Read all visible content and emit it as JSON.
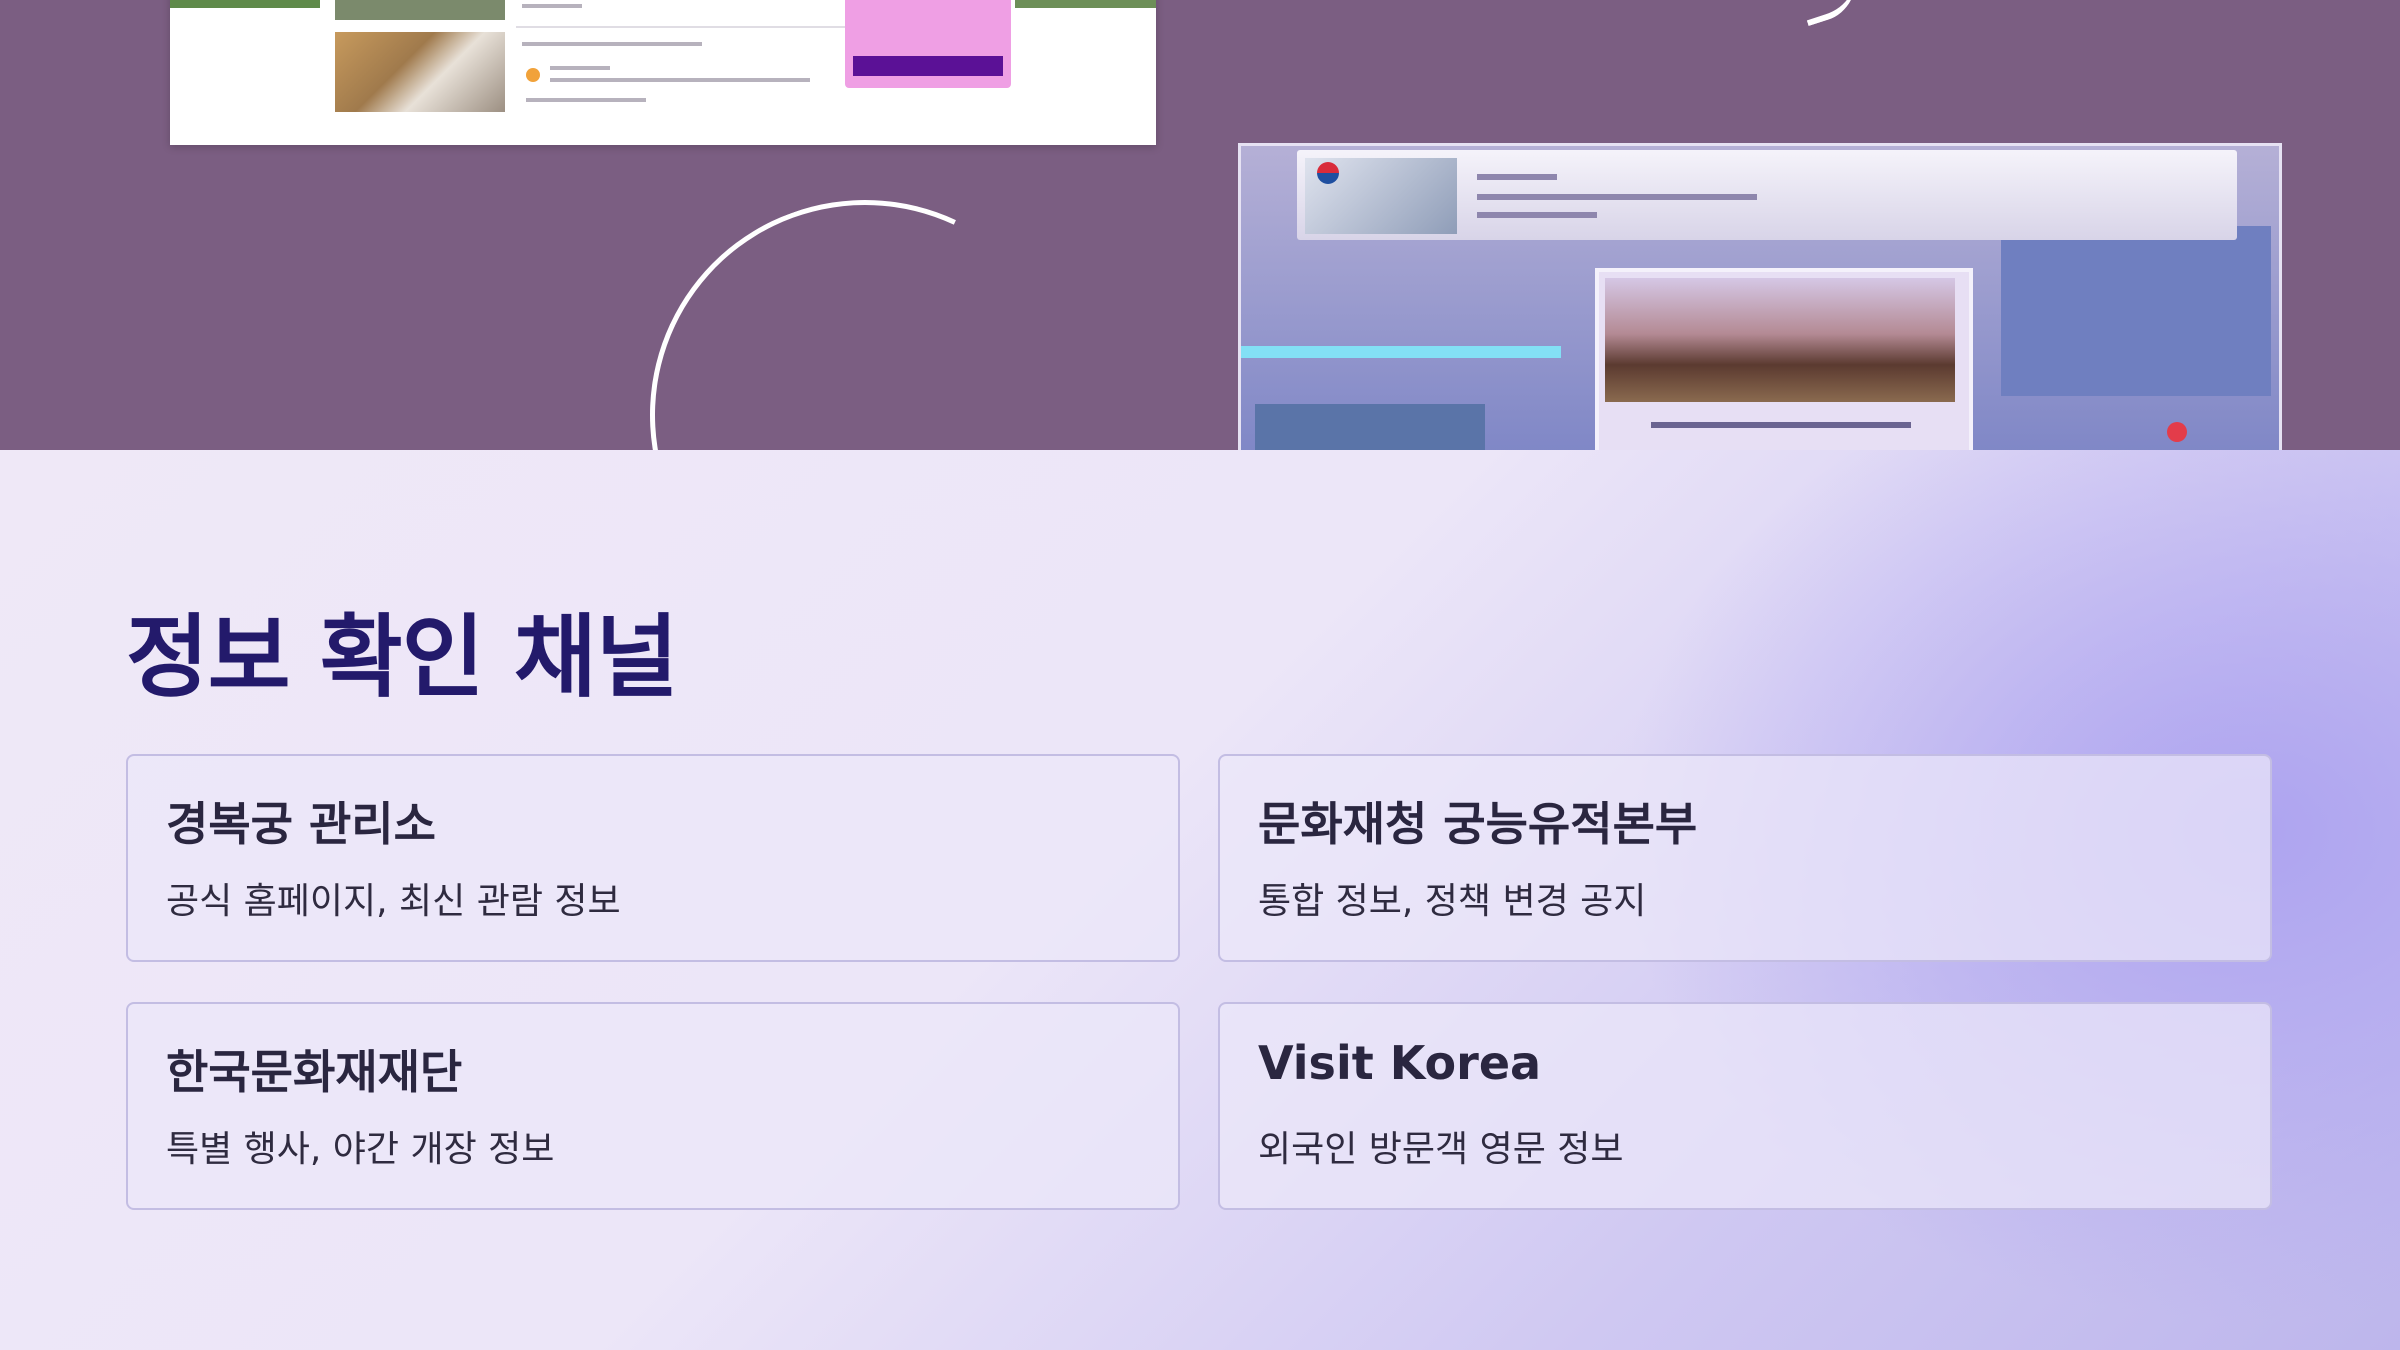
{
  "page": {
    "title": "정보 확인 채널",
    "accent_color": "#231a6b",
    "hero_background": "#7b5e82"
  },
  "cards": [
    {
      "title": "경복궁 관리소",
      "description": "공식 홈페이지, 최신 관람 정보"
    },
    {
      "title": "문화재청 궁능유적본부",
      "description": "통합 정보, 정책 변경 공지"
    },
    {
      "title": "한국문화재재단",
      "description": "특별 행사, 야간 개장 정보"
    },
    {
      "title": "Visit Korea",
      "description": "외국인 방문객 영문 정보"
    }
  ]
}
